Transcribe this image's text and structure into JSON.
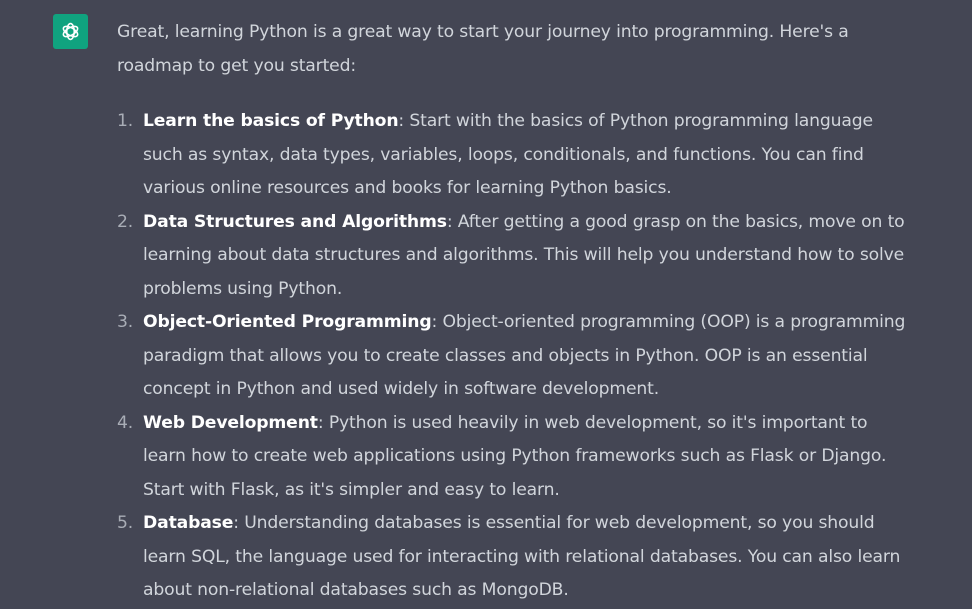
{
  "assistant": {
    "avatar_icon": "openai-logo-icon",
    "avatar_color": "#10a37f"
  },
  "message": {
    "intro": "Great, learning Python is a great way to start your journey into programming. Here's a roadmap to get you started:",
    "items": [
      {
        "number": "1.",
        "term": "Learn the basics of Python",
        "text": ": Start with the basics of Python programming language such as syntax, data types, variables, loops, conditionals, and functions. You can find various online resources and books for learning Python basics."
      },
      {
        "number": "2.",
        "term": "Data Structures and Algorithms",
        "text": ": After getting a good grasp on the basics, move on to learning about data structures and algorithms. This will help you understand how to solve problems using Python."
      },
      {
        "number": "3.",
        "term": "Object-Oriented Programming",
        "text": ": Object-oriented programming (OOP) is a programming paradigm that allows you to create classes and objects in Python. OOP is an essential concept in Python and used widely in software development."
      },
      {
        "number": "4.",
        "term": "Web Development",
        "text": ": Python is used heavily in web development, so it's important to learn how to create web applications using Python frameworks such as Flask or Django. Start with Flask, as it's simpler and easy to learn."
      },
      {
        "number": "5.",
        "term": "Database",
        "text": ": Understanding databases is essential for web development, so you should learn SQL, the language used for interacting with relational databases. You can also learn about non-relational databases such as MongoDB."
      }
    ]
  }
}
